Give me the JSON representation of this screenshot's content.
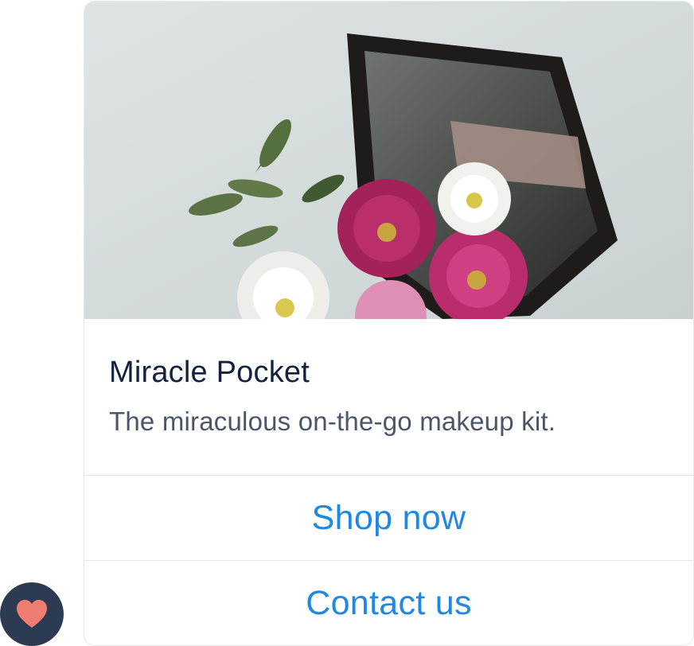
{
  "card": {
    "image_icon": "product-photo-compact-mirror-with-flowers",
    "title": "Miracle Pocket",
    "subtitle": "The miraculous on-the-go makeup kit.",
    "actions": [
      {
        "label": "Shop now"
      },
      {
        "label": "Contact us"
      }
    ]
  },
  "avatar": {
    "icon": "heart-icon",
    "background": "#2d3b52",
    "heart_color": "#f07d72"
  },
  "colors": {
    "action": "#1e88e5",
    "title": "#13233b",
    "subtitle": "#4b5668"
  }
}
